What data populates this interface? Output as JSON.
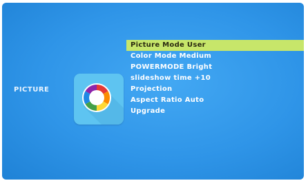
{
  "section": {
    "title": "PICTURE",
    "icon": "color-wheel-icon"
  },
  "menu": {
    "selected_index": 0,
    "items": [
      {
        "label": "Picture Mode User"
      },
      {
        "label": "Color Mode Medium"
      },
      {
        "label": "POWERMODE Bright"
      },
      {
        "label": "slideshow time +10"
      },
      {
        "label": "Projection"
      },
      {
        "label": "Aspect Ratio Auto"
      },
      {
        "label": "Upgrade"
      }
    ]
  },
  "colors": {
    "background": "#2f95e8",
    "highlight": "#c7e66a",
    "tile": "#5ec4f1",
    "text": "#ffffff"
  }
}
